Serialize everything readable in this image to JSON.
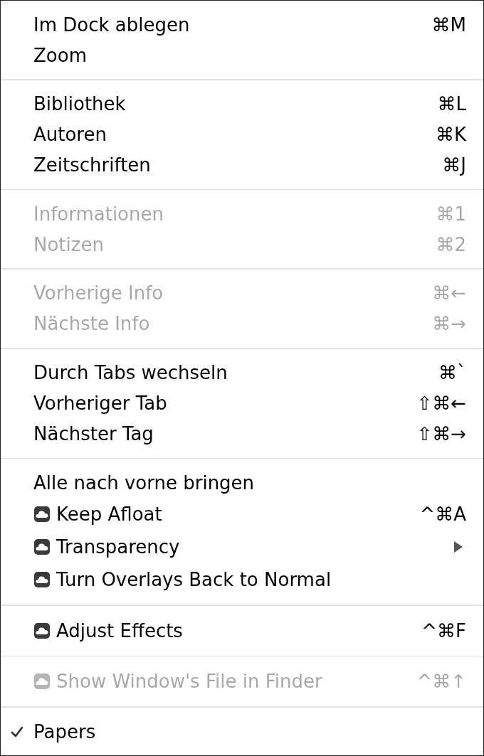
{
  "menu": {
    "groups": [
      {
        "items": [
          {
            "label": "Im Dock ablegen",
            "shortcut": "⌘M",
            "kind": "plain",
            "disabled": false,
            "checked": false,
            "submenu": false
          },
          {
            "label": "Zoom",
            "kind": "plain",
            "disabled": false,
            "checked": false,
            "submenu": false
          }
        ]
      },
      {
        "items": [
          {
            "label": "Bibliothek",
            "shortcut": "⌘L",
            "kind": "plain",
            "disabled": false,
            "checked": false,
            "submenu": false
          },
          {
            "label": "Autoren",
            "shortcut": "⌘K",
            "kind": "plain",
            "disabled": false,
            "checked": false,
            "submenu": false
          },
          {
            "label": "Zeitschriften",
            "shortcut": "⌘J",
            "kind": "plain",
            "disabled": false,
            "checked": false,
            "submenu": false
          }
        ]
      },
      {
        "items": [
          {
            "label": "Informationen",
            "shortcut": "⌘1",
            "kind": "plain",
            "disabled": true,
            "checked": false,
            "submenu": false
          },
          {
            "label": "Notizen",
            "shortcut": "⌘2",
            "kind": "plain",
            "disabled": true,
            "checked": false,
            "submenu": false
          }
        ]
      },
      {
        "items": [
          {
            "label": "Vorherige Info",
            "shortcut": "⌘←",
            "kind": "plain",
            "disabled": true,
            "checked": false,
            "submenu": false
          },
          {
            "label": "Nächste Info",
            "shortcut": "⌘→",
            "kind": "plain",
            "disabled": true,
            "checked": false,
            "submenu": false
          }
        ]
      },
      {
        "items": [
          {
            "label": "Durch Tabs wechseln",
            "shortcut": "⌘`",
            "kind": "plain",
            "disabled": false,
            "checked": false,
            "submenu": false
          },
          {
            "label": "Vorheriger Tab",
            "shortcut": "⇧⌘←",
            "kind": "plain",
            "disabled": false,
            "checked": false,
            "submenu": false
          },
          {
            "label": "Nächster Tag",
            "shortcut": "⇧⌘→",
            "kind": "plain",
            "disabled": false,
            "checked": false,
            "submenu": false
          }
        ]
      },
      {
        "items": [
          {
            "label": "Alle nach vorne bringen",
            "kind": "plain",
            "disabled": false,
            "checked": false,
            "submenu": false
          },
          {
            "label": "Keep Afloat",
            "shortcut": "^⌘A",
            "kind": "app",
            "disabled": false,
            "checked": false,
            "submenu": false
          },
          {
            "label": "Transparency",
            "kind": "app",
            "disabled": false,
            "checked": false,
            "submenu": true
          },
          {
            "label": "Turn Overlays Back to Normal",
            "kind": "app",
            "disabled": false,
            "checked": false,
            "submenu": false
          }
        ]
      },
      {
        "items": [
          {
            "label": "Adjust Effects",
            "shortcut": "^⌘F",
            "kind": "app",
            "disabled": false,
            "checked": false,
            "submenu": false
          }
        ]
      },
      {
        "items": [
          {
            "label": "Show Window's File in Finder",
            "shortcut": "^⌘↑",
            "kind": "app",
            "disabled": true,
            "checked": false,
            "submenu": false
          }
        ]
      },
      {
        "items": [
          {
            "label": "Papers",
            "kind": "plain",
            "disabled": false,
            "checked": true,
            "submenu": false
          }
        ]
      }
    ]
  }
}
